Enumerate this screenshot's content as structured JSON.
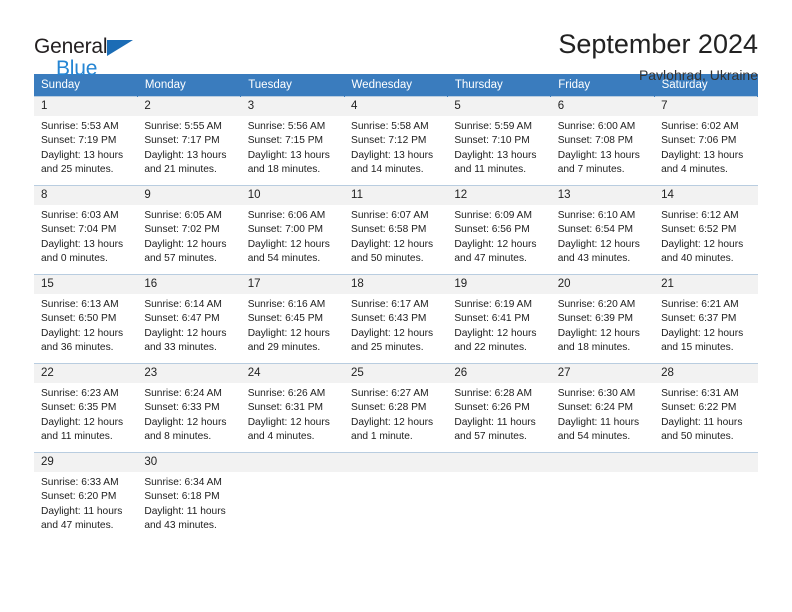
{
  "brand": {
    "name_top": "General",
    "name_bottom": "Blue",
    "triangle_color": "#1b6cb5",
    "blue_text_color": "#2585d3"
  },
  "header": {
    "title": "September 2024",
    "subtitle": "Pavlohrad, Ukraine"
  },
  "calendar": {
    "header_bg": "#3a7cbe",
    "daynum_bg": "#f2f2f2",
    "weekday_headers": [
      "Sunday",
      "Monday",
      "Tuesday",
      "Wednesday",
      "Thursday",
      "Friday",
      "Saturday"
    ],
    "weeks": [
      [
        {
          "day": "1",
          "sunrise": "Sunrise: 5:53 AM",
          "sunset": "Sunset: 7:19 PM",
          "daylight_line1": "Daylight: 13 hours",
          "daylight_line2": "and 25 minutes."
        },
        {
          "day": "2",
          "sunrise": "Sunrise: 5:55 AM",
          "sunset": "Sunset: 7:17 PM",
          "daylight_line1": "Daylight: 13 hours",
          "daylight_line2": "and 21 minutes."
        },
        {
          "day": "3",
          "sunrise": "Sunrise: 5:56 AM",
          "sunset": "Sunset: 7:15 PM",
          "daylight_line1": "Daylight: 13 hours",
          "daylight_line2": "and 18 minutes."
        },
        {
          "day": "4",
          "sunrise": "Sunrise: 5:58 AM",
          "sunset": "Sunset: 7:12 PM",
          "daylight_line1": "Daylight: 13 hours",
          "daylight_line2": "and 14 minutes."
        },
        {
          "day": "5",
          "sunrise": "Sunrise: 5:59 AM",
          "sunset": "Sunset: 7:10 PM",
          "daylight_line1": "Daylight: 13 hours",
          "daylight_line2": "and 11 minutes."
        },
        {
          "day": "6",
          "sunrise": "Sunrise: 6:00 AM",
          "sunset": "Sunset: 7:08 PM",
          "daylight_line1": "Daylight: 13 hours",
          "daylight_line2": "and 7 minutes."
        },
        {
          "day": "7",
          "sunrise": "Sunrise: 6:02 AM",
          "sunset": "Sunset: 7:06 PM",
          "daylight_line1": "Daylight: 13 hours",
          "daylight_line2": "and 4 minutes."
        }
      ],
      [
        {
          "day": "8",
          "sunrise": "Sunrise: 6:03 AM",
          "sunset": "Sunset: 7:04 PM",
          "daylight_line1": "Daylight: 13 hours",
          "daylight_line2": "and 0 minutes."
        },
        {
          "day": "9",
          "sunrise": "Sunrise: 6:05 AM",
          "sunset": "Sunset: 7:02 PM",
          "daylight_line1": "Daylight: 12 hours",
          "daylight_line2": "and 57 minutes."
        },
        {
          "day": "10",
          "sunrise": "Sunrise: 6:06 AM",
          "sunset": "Sunset: 7:00 PM",
          "daylight_line1": "Daylight: 12 hours",
          "daylight_line2": "and 54 minutes."
        },
        {
          "day": "11",
          "sunrise": "Sunrise: 6:07 AM",
          "sunset": "Sunset: 6:58 PM",
          "daylight_line1": "Daylight: 12 hours",
          "daylight_line2": "and 50 minutes."
        },
        {
          "day": "12",
          "sunrise": "Sunrise: 6:09 AM",
          "sunset": "Sunset: 6:56 PM",
          "daylight_line1": "Daylight: 12 hours",
          "daylight_line2": "and 47 minutes."
        },
        {
          "day": "13",
          "sunrise": "Sunrise: 6:10 AM",
          "sunset": "Sunset: 6:54 PM",
          "daylight_line1": "Daylight: 12 hours",
          "daylight_line2": "and 43 minutes."
        },
        {
          "day": "14",
          "sunrise": "Sunrise: 6:12 AM",
          "sunset": "Sunset: 6:52 PM",
          "daylight_line1": "Daylight: 12 hours",
          "daylight_line2": "and 40 minutes."
        }
      ],
      [
        {
          "day": "15",
          "sunrise": "Sunrise: 6:13 AM",
          "sunset": "Sunset: 6:50 PM",
          "daylight_line1": "Daylight: 12 hours",
          "daylight_line2": "and 36 minutes."
        },
        {
          "day": "16",
          "sunrise": "Sunrise: 6:14 AM",
          "sunset": "Sunset: 6:47 PM",
          "daylight_line1": "Daylight: 12 hours",
          "daylight_line2": "and 33 minutes."
        },
        {
          "day": "17",
          "sunrise": "Sunrise: 6:16 AM",
          "sunset": "Sunset: 6:45 PM",
          "daylight_line1": "Daylight: 12 hours",
          "daylight_line2": "and 29 minutes."
        },
        {
          "day": "18",
          "sunrise": "Sunrise: 6:17 AM",
          "sunset": "Sunset: 6:43 PM",
          "daylight_line1": "Daylight: 12 hours",
          "daylight_line2": "and 25 minutes."
        },
        {
          "day": "19",
          "sunrise": "Sunrise: 6:19 AM",
          "sunset": "Sunset: 6:41 PM",
          "daylight_line1": "Daylight: 12 hours",
          "daylight_line2": "and 22 minutes."
        },
        {
          "day": "20",
          "sunrise": "Sunrise: 6:20 AM",
          "sunset": "Sunset: 6:39 PM",
          "daylight_line1": "Daylight: 12 hours",
          "daylight_line2": "and 18 minutes."
        },
        {
          "day": "21",
          "sunrise": "Sunrise: 6:21 AM",
          "sunset": "Sunset: 6:37 PM",
          "daylight_line1": "Daylight: 12 hours",
          "daylight_line2": "and 15 minutes."
        }
      ],
      [
        {
          "day": "22",
          "sunrise": "Sunrise: 6:23 AM",
          "sunset": "Sunset: 6:35 PM",
          "daylight_line1": "Daylight: 12 hours",
          "daylight_line2": "and 11 minutes."
        },
        {
          "day": "23",
          "sunrise": "Sunrise: 6:24 AM",
          "sunset": "Sunset: 6:33 PM",
          "daylight_line1": "Daylight: 12 hours",
          "daylight_line2": "and 8 minutes."
        },
        {
          "day": "24",
          "sunrise": "Sunrise: 6:26 AM",
          "sunset": "Sunset: 6:31 PM",
          "daylight_line1": "Daylight: 12 hours",
          "daylight_line2": "and 4 minutes."
        },
        {
          "day": "25",
          "sunrise": "Sunrise: 6:27 AM",
          "sunset": "Sunset: 6:28 PM",
          "daylight_line1": "Daylight: 12 hours",
          "daylight_line2": "and 1 minute."
        },
        {
          "day": "26",
          "sunrise": "Sunrise: 6:28 AM",
          "sunset": "Sunset: 6:26 PM",
          "daylight_line1": "Daylight: 11 hours",
          "daylight_line2": "and 57 minutes."
        },
        {
          "day": "27",
          "sunrise": "Sunrise: 6:30 AM",
          "sunset": "Sunset: 6:24 PM",
          "daylight_line1": "Daylight: 11 hours",
          "daylight_line2": "and 54 minutes."
        },
        {
          "day": "28",
          "sunrise": "Sunrise: 6:31 AM",
          "sunset": "Sunset: 6:22 PM",
          "daylight_line1": "Daylight: 11 hours",
          "daylight_line2": "and 50 minutes."
        }
      ],
      [
        {
          "day": "29",
          "sunrise": "Sunrise: 6:33 AM",
          "sunset": "Sunset: 6:20 PM",
          "daylight_line1": "Daylight: 11 hours",
          "daylight_line2": "and 47 minutes."
        },
        {
          "day": "30",
          "sunrise": "Sunrise: 6:34 AM",
          "sunset": "Sunset: 6:18 PM",
          "daylight_line1": "Daylight: 11 hours",
          "daylight_line2": "and 43 minutes."
        },
        {
          "day": "",
          "sunrise": "",
          "sunset": "",
          "daylight_line1": "",
          "daylight_line2": ""
        },
        {
          "day": "",
          "sunrise": "",
          "sunset": "",
          "daylight_line1": "",
          "daylight_line2": ""
        },
        {
          "day": "",
          "sunrise": "",
          "sunset": "",
          "daylight_line1": "",
          "daylight_line2": ""
        },
        {
          "day": "",
          "sunrise": "",
          "sunset": "",
          "daylight_line1": "",
          "daylight_line2": ""
        },
        {
          "day": "",
          "sunrise": "",
          "sunset": "",
          "daylight_line1": "",
          "daylight_line2": ""
        }
      ]
    ]
  }
}
